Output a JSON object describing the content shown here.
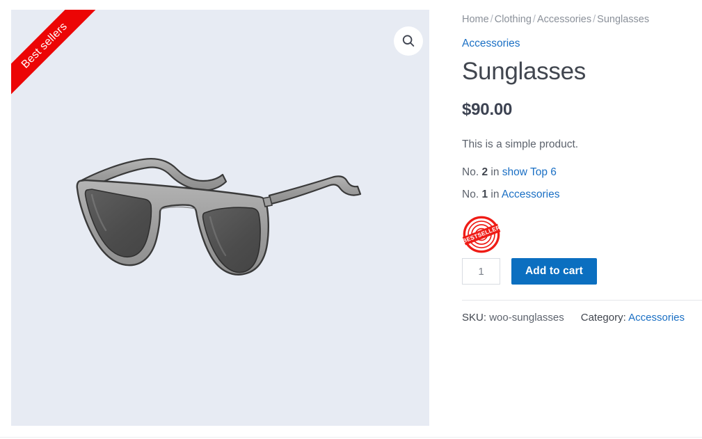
{
  "gallery": {
    "ribbon_label": "Best sellers",
    "zoom_icon": "magnifier-icon",
    "image_alt": "Sunglasses",
    "background_color": "#e7ebf3"
  },
  "breadcrumb": {
    "items": [
      {
        "label": "Home"
      },
      {
        "label": "Clothing"
      },
      {
        "label": "Accessories"
      },
      {
        "label": "Sunglasses"
      }
    ],
    "separator": "/"
  },
  "product": {
    "category_link": "Accessories",
    "title": "Sunglasses",
    "price": "$90.00",
    "short_description": "This is a simple product.",
    "rankings": [
      {
        "prefix": "No.",
        "rank": "2",
        "middle": "in",
        "list_name": "show Top 6"
      },
      {
        "prefix": "No.",
        "rank": "1",
        "middle": "in",
        "list_name": "Accessories"
      }
    ],
    "badge": {
      "name": "bestseller-stamp",
      "text": "BESTSELLER",
      "color": "#ef1c16"
    }
  },
  "cart": {
    "quantity_value": "1",
    "quantity_placeholder": "1",
    "add_to_cart_label": "Add to cart",
    "button_color": "#0b6fc0"
  },
  "meta": {
    "sku_label": "SKU:",
    "sku_value": "woo-sunglasses",
    "category_label": "Category:",
    "category_value": "Accessories"
  },
  "colors": {
    "link": "#1a6fc4",
    "accent_red": "#ec0505",
    "text": "#5d636d",
    "heading": "#41464f"
  }
}
